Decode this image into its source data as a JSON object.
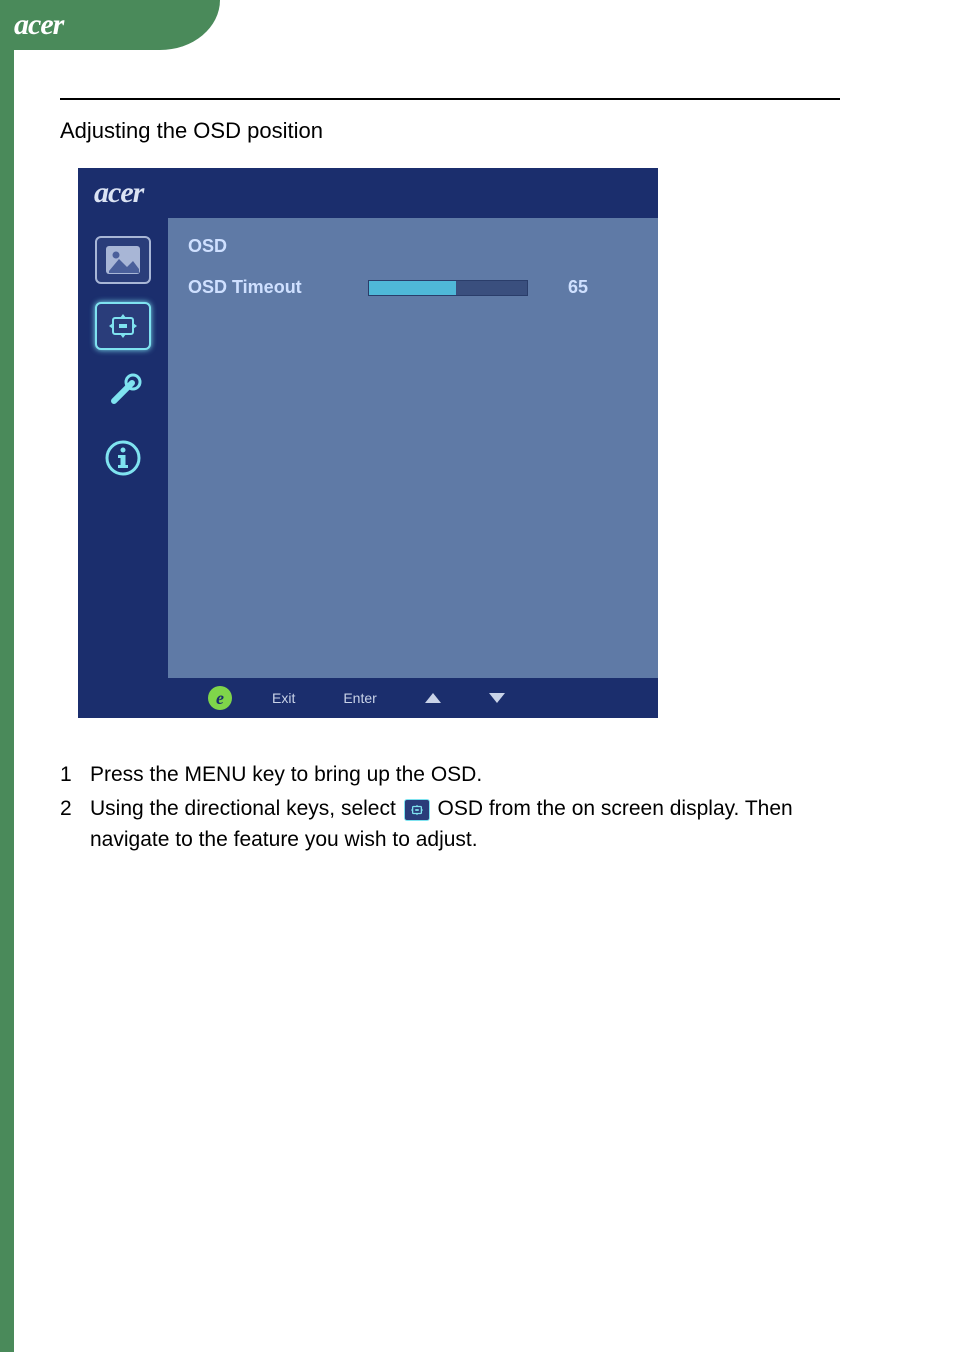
{
  "header": {
    "brand": "acer"
  },
  "title": "Adjusting the OSD position",
  "osd": {
    "brand": "acer",
    "heading": "OSD",
    "row": {
      "label": "OSD Timeout",
      "value": "65",
      "fill_percent": 55
    },
    "icons": {
      "picture": "picture-icon",
      "osd_position": "osd-position-icon",
      "settings": "settings-icon",
      "info": "info-icon"
    },
    "footer": {
      "empowering": "e",
      "exit": "Exit",
      "enter": "Enter",
      "up": "▲",
      "down": "▼"
    }
  },
  "instructions": [
    {
      "num": "1",
      "text_before": "Press the MENU key to bring up the OSD.",
      "has_icon": false,
      "text_after": ""
    },
    {
      "num": "2",
      "text_before": "Using the directional keys, select ",
      "has_icon": true,
      "text_after": " OSD from the on screen display. Then navigate to the feature you wish to adjust."
    }
  ]
}
